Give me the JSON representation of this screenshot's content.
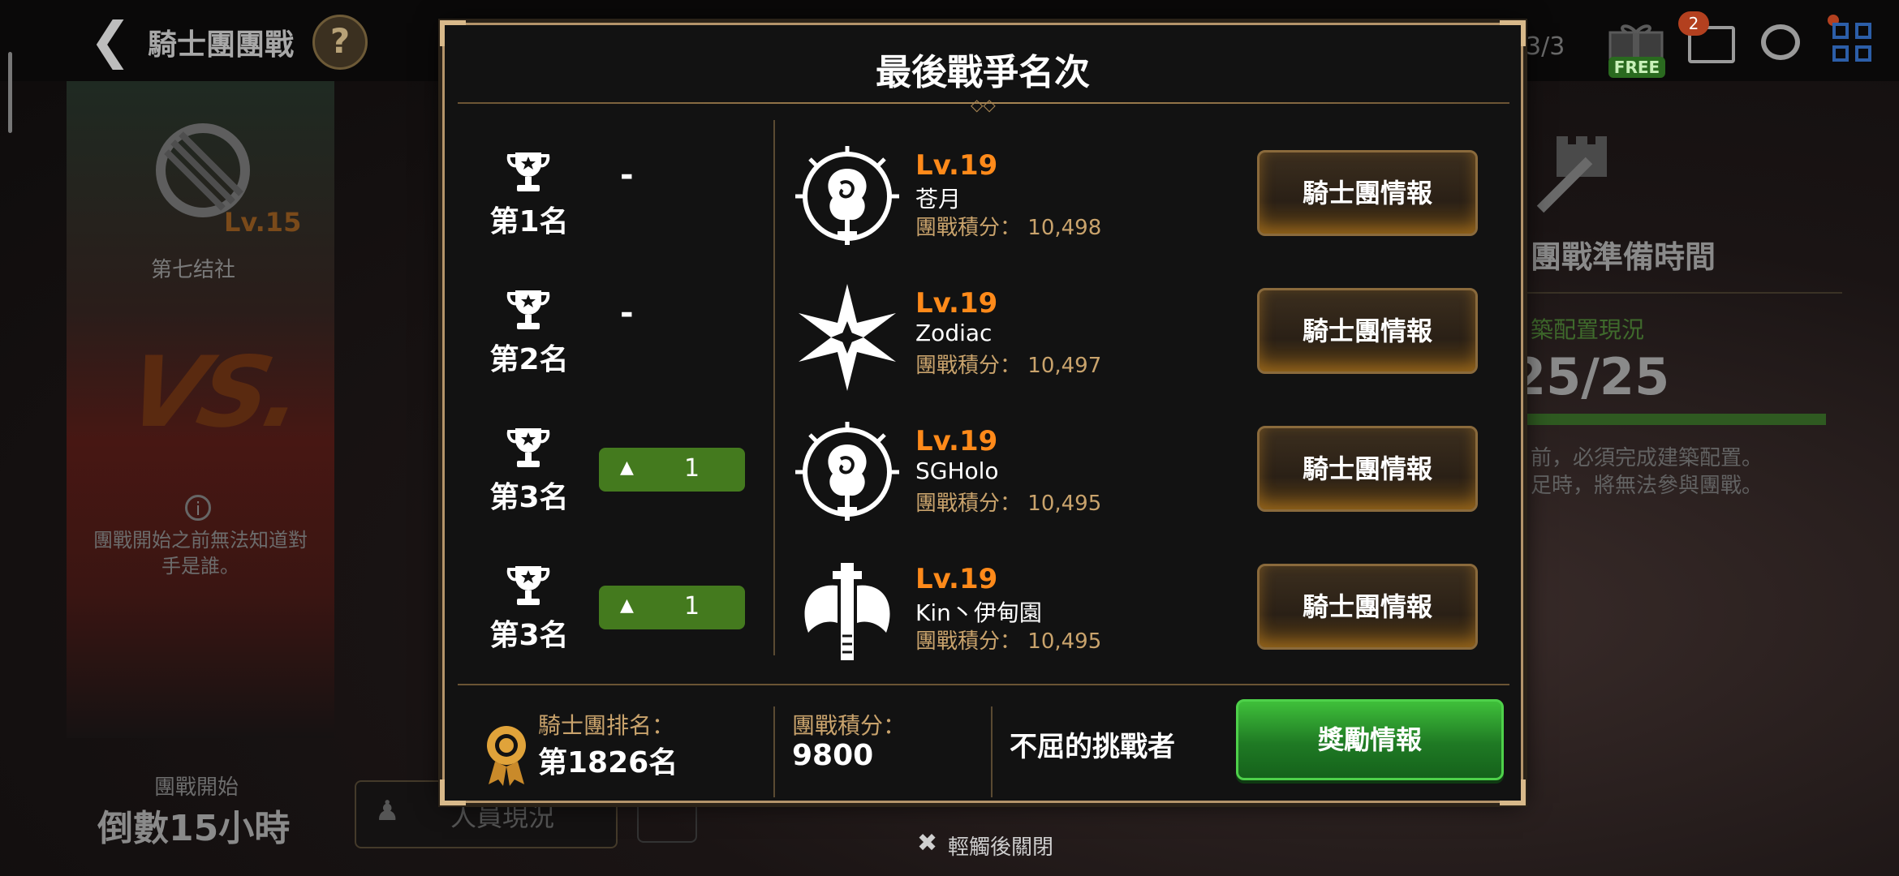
{
  "background": {
    "title": "騎士團團戰",
    "help": "?",
    "page_count": "3/3",
    "free_tag": "FREE",
    "mail_badge": "2",
    "guild_level": "Lv.15",
    "guild_name": "第七结社",
    "vs": "VS.",
    "note": "團戰開始之前無法知道對手是誰。",
    "start_label": "團戰開始",
    "countdown": "倒數15小時",
    "member_button": "人員現況",
    "prep_title": "團戰準備時間",
    "build_status": "築配置現況",
    "build_count": "25/25",
    "build_progress": 1.0,
    "prep_note_1": "前，必須完成建築配置。",
    "prep_note_2": "足時，將無法參與團戰。"
  },
  "modal": {
    "title": "最後戰爭名次",
    "rows": [
      {
        "rank": "第1名",
        "change": "-",
        "change_dir": "none",
        "level": "Lv.19",
        "name": "苍月",
        "score_label": "團戰積分：",
        "score": "10,498",
        "emblem": "rose-emblem-icon",
        "button": "騎士團情報"
      },
      {
        "rank": "第2名",
        "change": "-",
        "change_dir": "none",
        "level": "Lv.19",
        "name": "Zodiac",
        "score_label": "團戰積分：",
        "score": "10,497",
        "emblem": "star-emblem-icon",
        "button": "騎士團情報"
      },
      {
        "rank": "第3名",
        "change": "1",
        "change_dir": "up",
        "level": "Lv.19",
        "name": "SGHolo",
        "score_label": "團戰積分：",
        "score": "10,495",
        "emblem": "rose-emblem-icon",
        "button": "騎士團情報"
      },
      {
        "rank": "第3名",
        "change": "1",
        "change_dir": "up",
        "level": "Lv.19",
        "name": "Kin丶伊甸園",
        "score_label": "團戰積分：",
        "score": "10,495",
        "emblem": "axe-emblem-icon",
        "button": "騎士團情報"
      }
    ],
    "footer": {
      "rank_label": "騎士團排名：",
      "rank_value": "第1826名",
      "score_label": "團戰積分：",
      "score_value": "9800",
      "title_name": "不屈的挑戰者",
      "reward_button": "獎勵情報"
    }
  },
  "close_hint": "輕觸後關閉",
  "colors": {
    "accent_gold": "#b4946a",
    "level_orange": "#ff8a1a",
    "score_gold": "#c9a36c",
    "rank_up_green": "#447a1e",
    "reward_green": "#1f7a24"
  }
}
